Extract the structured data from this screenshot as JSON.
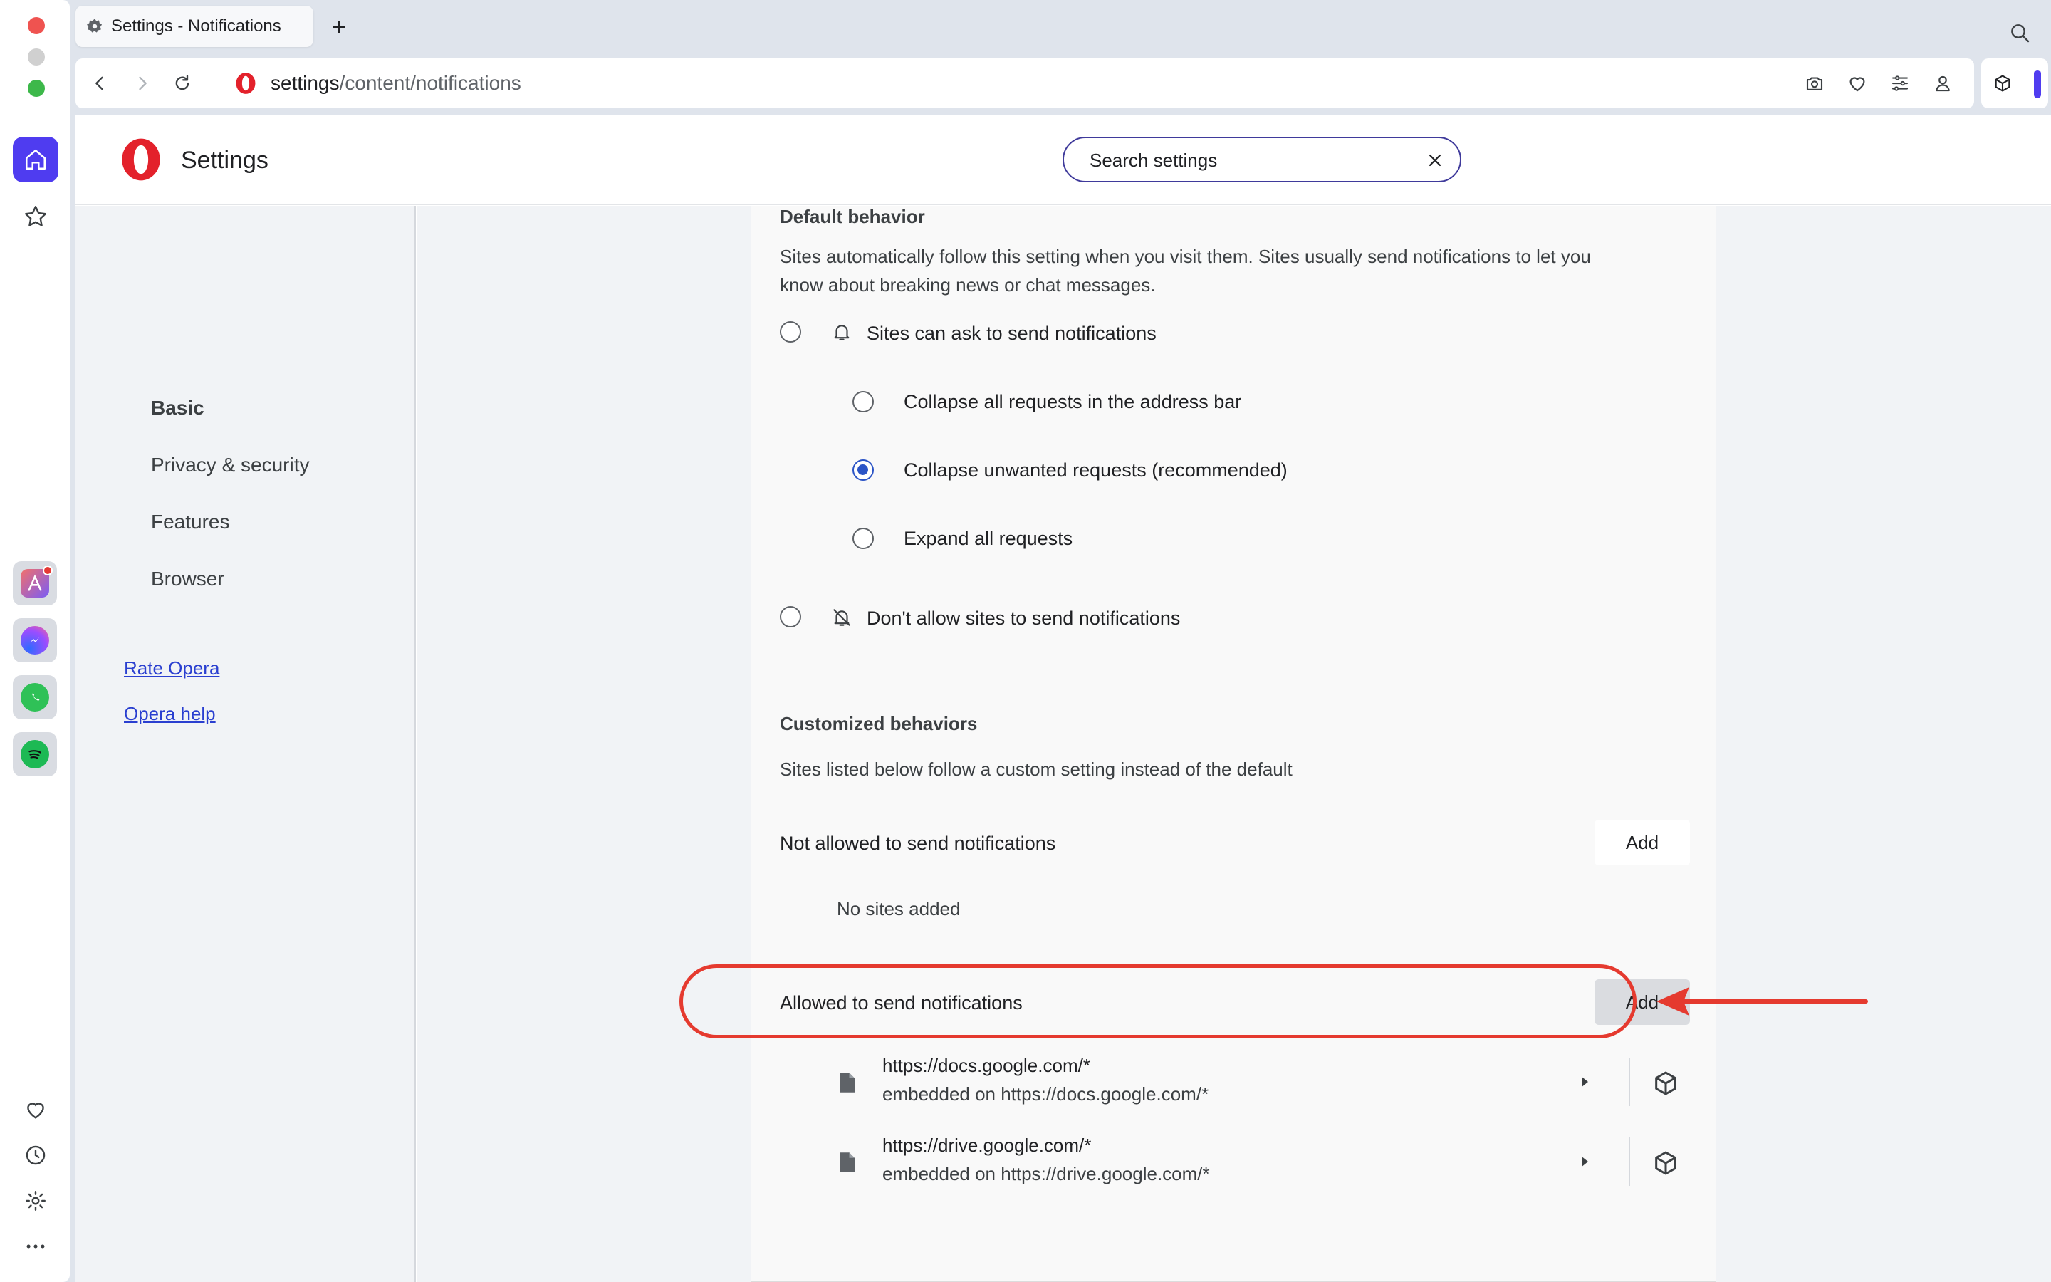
{
  "browser": {
    "tab_title": "Settings - Notifications",
    "url_host": "settings",
    "url_path": "/content/notifications"
  },
  "settings": {
    "title": "Settings",
    "search_placeholder": "Search settings"
  },
  "sidebar": {
    "items": [
      {
        "label": "Basic",
        "active": true
      },
      {
        "label": "Privacy & security"
      },
      {
        "label": "Features"
      },
      {
        "label": "Browser"
      }
    ],
    "links": [
      "Rate Opera",
      "Opera help"
    ]
  },
  "default_behavior": {
    "heading": "Default behavior",
    "description_line1": "Sites automatically follow this setting when you visit them. Sites usually send notifications to let you",
    "description_line2": "know about breaking news or chat messages.",
    "options": {
      "ask": "Sites can ask to send notifications",
      "collapse_all": "Collapse all requests in the address bar",
      "collapse_unwanted": "Collapse unwanted requests (recommended)",
      "expand_all": "Expand all requests",
      "block": "Don't allow sites to send notifications"
    },
    "selected_sub_option": "collapse_unwanted"
  },
  "customized": {
    "heading": "Customized behaviors",
    "description": "Sites listed below follow a custom setting instead of the default",
    "not_allowed": {
      "title": "Not allowed to send notifications",
      "add_label": "Add",
      "empty": "No sites added"
    },
    "allowed": {
      "title": "Allowed to send notifications",
      "add_label": "Add",
      "sites": [
        {
          "url": "https://docs.google.com/*",
          "embedded": "embedded on https://docs.google.com/*"
        },
        {
          "url": "https://drive.google.com/*",
          "embedded": "embedded on https://drive.google.com/*"
        }
      ]
    }
  },
  "annotation": {
    "color": "#e53a2f"
  },
  "colors": {
    "accent": "#4f3cf0",
    "radio_selected": "#2b54c6",
    "link": "#2a3fd0"
  }
}
